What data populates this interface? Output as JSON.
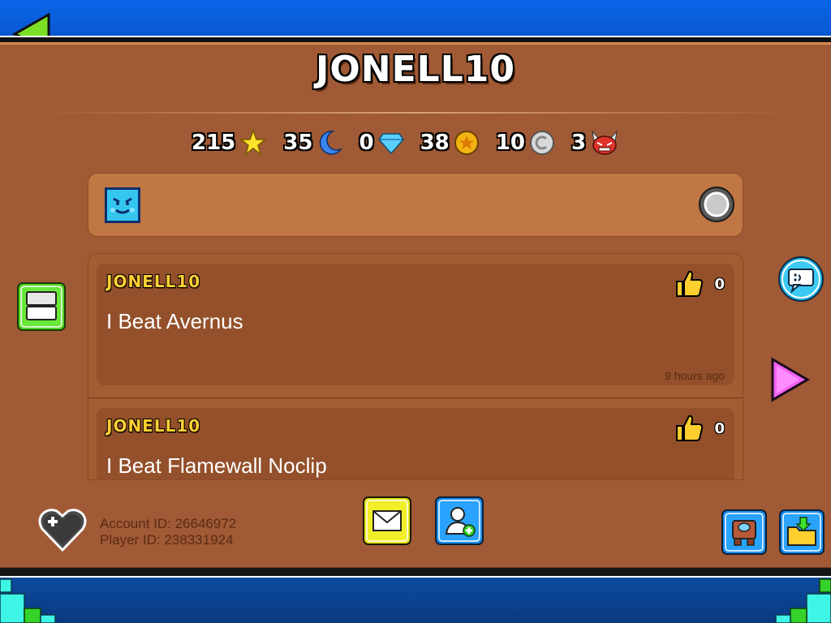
{
  "profile": {
    "username": "JONELL10",
    "account_id_text": "Account ID: 26646972",
    "player_id_text": "Player ID: 238331924"
  },
  "stats": [
    {
      "value": "215",
      "icon": "star-icon"
    },
    {
      "value": "35",
      "icon": "moon-icon"
    },
    {
      "value": "0",
      "icon": "diamond-icon"
    },
    {
      "value": "38",
      "icon": "secret-coin-icon"
    },
    {
      "value": "10",
      "icon": "user-coin-icon"
    },
    {
      "value": "3",
      "icon": "demon-icon"
    }
  ],
  "comments": [
    {
      "user": "JONELL10",
      "text": "I Beat Avernus",
      "likes": "0",
      "time": "9 hours ago"
    },
    {
      "user": "JONELL10",
      "text": "I Beat Flamewall Noclip",
      "likes": "0",
      "time": ""
    }
  ],
  "colors": {
    "panel": "#a05a35",
    "accent_yellow": "#ffcf30",
    "top_bar": "#0a66e8"
  }
}
